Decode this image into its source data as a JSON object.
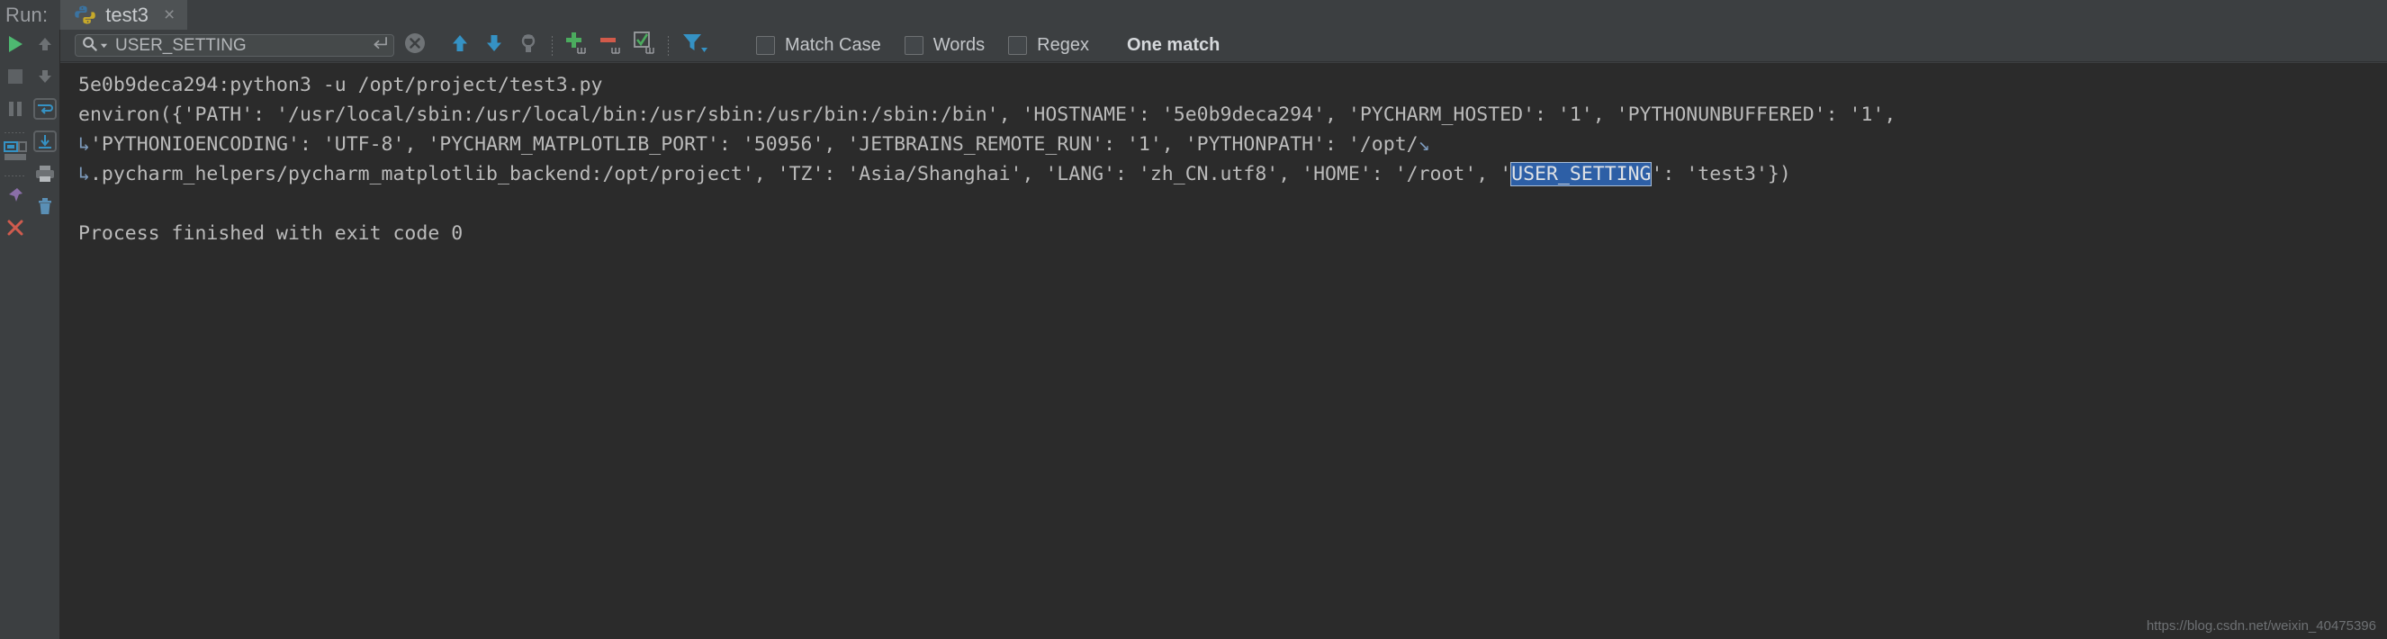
{
  "window": {
    "run_label": "Run:",
    "tab": {
      "title": "test3",
      "icon": "python-icon",
      "close": "×"
    }
  },
  "left_gutter": {
    "primary": [
      {
        "name": "rerun-button",
        "icon": "play-icon"
      },
      {
        "name": "stop-button",
        "icon": "stop-square-icon"
      },
      {
        "name": "pause-button",
        "icon": "pause-icon"
      },
      {
        "name": "console-toggle-button",
        "icon": "console-window-icon"
      },
      {
        "name": "close-tab-button",
        "icon": "close-x-icon"
      }
    ],
    "secondary": [
      {
        "name": "scroll-up-button",
        "icon": "arrow-up-icon"
      },
      {
        "name": "scroll-down-button",
        "icon": "arrow-down-icon"
      },
      {
        "name": "soft-wrap-button",
        "icon": "soft-wrap-icon"
      },
      {
        "name": "scroll-to-end-button",
        "icon": "scroll-end-icon"
      },
      {
        "name": "print-button",
        "icon": "printer-icon"
      },
      {
        "name": "clear-all-button",
        "icon": "trash-icon"
      }
    ]
  },
  "search": {
    "value": "USER_SETTING",
    "placeholder": "Search",
    "magnifier_icon": "search-icon",
    "dropdown_icon": "chevron-down-icon",
    "enter_icon": "enter-return-icon",
    "clear_icon": "clear-circle-x-icon",
    "buttons": [
      {
        "name": "find-previous-button",
        "icon": "arrow-up-icon",
        "label": "Find Previous"
      },
      {
        "name": "find-next-button",
        "icon": "arrow-down-icon",
        "label": "Find Next"
      },
      {
        "name": "find-all-button",
        "icon": "find-all-icon",
        "label": "Find All"
      },
      {
        "name": "add-filter-button",
        "icon": "plus-icon",
        "label": "Add"
      },
      {
        "name": "remove-filter-button",
        "icon": "minus-icon",
        "label": "Remove"
      },
      {
        "name": "edit-filter-button",
        "icon": "checkbox-edit-icon",
        "label": "Edit"
      },
      {
        "name": "filter-button",
        "icon": "funnel-filter-icon",
        "label": "Filter"
      }
    ],
    "options": [
      {
        "label": "Match Case",
        "checked": false
      },
      {
        "label": "Words",
        "checked": false
      },
      {
        "label": "Regex",
        "checked": false
      }
    ],
    "result_status": "One match"
  },
  "console": {
    "lines": [
      {
        "id": "line-command",
        "wrapped": false,
        "parts": [
          {
            "t": "5e0b9deca294:python3 -u /opt/project/test3.py",
            "hl": false
          }
        ]
      },
      {
        "id": "line-environ-1",
        "wrapped": false,
        "parts": [
          {
            "t": "environ({'PATH': '/usr/local/sbin:/usr/local/bin:/usr/sbin:/usr/bin:/sbin:/bin', 'HOSTNAME': '5e0b9deca294', 'PYCHARM_HOSTED': '1', 'PYTHONUNBUFFERED': '1',",
            "hl": false
          }
        ]
      },
      {
        "id": "line-environ-2",
        "wrapped": true,
        "parts": [
          {
            "t": "'PYTHONIOENCODING': 'UTF-8', 'PYCHARM_MATPLOTLIB_PORT': '50956', 'JETBRAINS_REMOTE_RUN': '1', 'PYTHONPATH': '/opt/",
            "hl": false
          }
        ]
      },
      {
        "id": "line-environ-3",
        "wrapped": true,
        "parts": [
          {
            "t": ".pycharm_helpers/pycharm_matplotlib_backend:/opt/project', 'TZ': 'Asia/Shanghai', 'LANG': 'zh_CN.utf8', 'HOME': '/root', '",
            "hl": false
          },
          {
            "t": "USER_SETTING",
            "hl": true
          },
          {
            "t": "': 'test3'})",
            "hl": false
          }
        ]
      },
      {
        "id": "line-blank",
        "blank": true,
        "parts": []
      },
      {
        "id": "line-exit",
        "wrapped": false,
        "parts": [
          {
            "t": "Process finished with exit code 0",
            "hl": false
          }
        ]
      }
    ],
    "wrap_indicator": "↳"
  },
  "watermark": "https://blog.csdn.net/weixin_40475396",
  "colors": {
    "chrome_bg": "#3c3f41",
    "console_bg": "#2b2b2b",
    "console_text": "#bbbbbb",
    "highlight_bg": "#2d5fa6",
    "accent_blue": "#3592c4",
    "run_green": "#4eb871",
    "remove_red": "#d25a4a",
    "check_green": "#5fa85f"
  }
}
